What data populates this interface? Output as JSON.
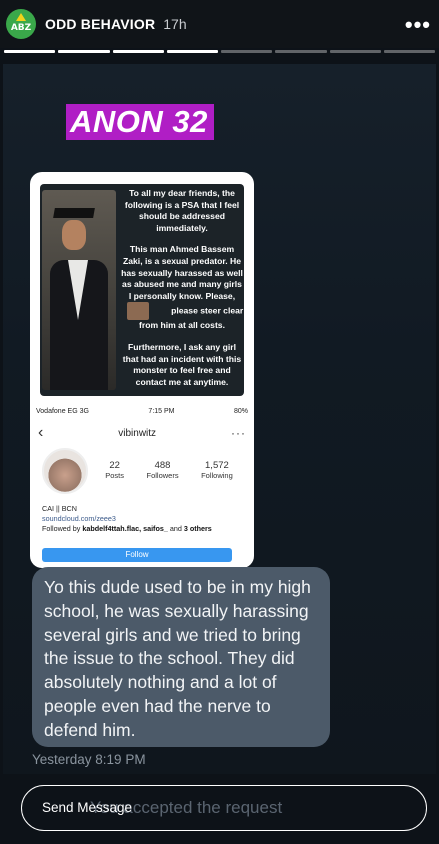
{
  "header": {
    "avatar_text": "ABZ",
    "username": "ODD BEHAVIOR",
    "time": "17h",
    "more_label": "•••"
  },
  "progress": {
    "total_segments": 8,
    "completed_segments": 4
  },
  "story": {
    "tag": "ANON 32",
    "post": {
      "p1": "To all my dear friends, the following is a PSA that I feel should be addressed immediately.",
      "p2": "This man Ahmed Bassem Zaki, is a sexual predator. He has sexually harassed as well as abused me and many girls I personally know. Please,",
      "p2b": "please steer clear from him at all costs.",
      "p3": "Furthermore, I ask any girl that had an incident with this monster to feel free and contact me at anytime."
    },
    "profile": {
      "carrier": "Vodafone EG  3G",
      "clock": "7:15 PM",
      "battery": "80%",
      "handle": "vibinwitz",
      "posts_num": "22",
      "posts_label": "Posts",
      "followers_num": "488",
      "followers_label": "Followers",
      "following_num": "1,572",
      "following_label": "Following",
      "bio_line1": "CAI || BCN",
      "bio_link": "soundcloud.com/zeee3",
      "followed_by_prefix": "Followed by ",
      "followed_by_names": "kabdelf4ttah.flac, saifos_",
      "followed_by_mid": " and ",
      "followed_by_others": "3 others",
      "follow_button": "Follow"
    }
  },
  "message": {
    "text": "Yo this dude used to be in my high school, he was sexually harassing several girls and we tried to bring the issue to the school. They did absolutely nothing and a lot of people even had the nerve to defend him.",
    "timestamp": "Yesterday 8:19 PM"
  },
  "composer": {
    "placeholder": "Send Message",
    "ghost_text": "You accepted the request"
  }
}
